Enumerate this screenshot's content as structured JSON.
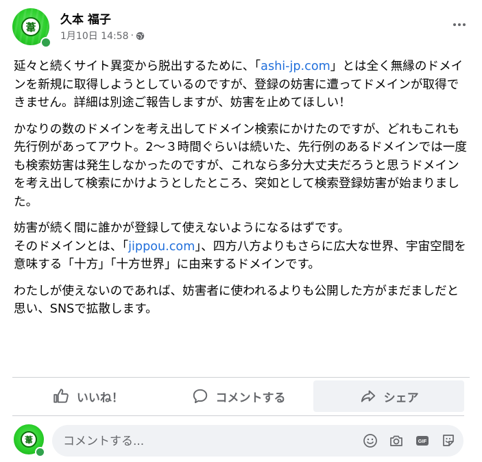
{
  "post": {
    "author": "久本 福子",
    "avatar_glyph": "葦",
    "timestamp": "1月10日 14:58",
    "separator": "·",
    "privacy_icon": "globe-icon",
    "more_icon": "more-horizontal-icon"
  },
  "body": {
    "p1": {
      "before": "延々と続くサイト異変から脱出するために、「",
      "link": "ashi-jp.com",
      "after": "」とは全く無縁のドメインを新規に取得しようとしているのですが、登録の妨害に遭ってドメインが取得できません。詳細は別途ご報告しますが、妨害を止めてほしい！"
    },
    "p2": "かなりの数のドメインを考え出してドメイン検索にかけたのですが、どれもこれも先行例があってアウト。2～３時間ぐらいは続いた、先行例のあるドメインでは一度も検索妨害は発生しなかったのですが、これなら多分大丈夫だろうと思うドメインを考え出して検索にかけようとしたところ、突如として検索登録妨害が始まりました。",
    "p3": {
      "line1": "妨害が続く間に誰かが登録して使えないようになるはずです。",
      "before": "そのドメインとは、「",
      "link": "jippou.com",
      "after": "」、四方八方よりもさらに広大な世界、宇宙空間を意味する「十方」「十方世界」に由来するドメインです。"
    },
    "p4": "わたしが使えないのであれば、妨害者に使われるよりも公開した方がまだましだと思い、SNSで拡散します。"
  },
  "actions": {
    "like": {
      "label": "いいね！",
      "icon": "thumbs-up-icon"
    },
    "comment": {
      "label": "コメントする",
      "icon": "speech-bubble-icon"
    },
    "share": {
      "label": "シェア",
      "icon": "share-arrow-icon"
    }
  },
  "composer": {
    "placeholder": "コメントする...",
    "icons": [
      "emoji-icon",
      "camera-icon",
      "gif-icon",
      "sticker-icon"
    ]
  },
  "colors": {
    "link": "#216fdb",
    "muted": "#65676b",
    "online": "#31a24c",
    "avatar_green": "#2bcf2b",
    "pressed_bg": "#f0f2f5"
  }
}
